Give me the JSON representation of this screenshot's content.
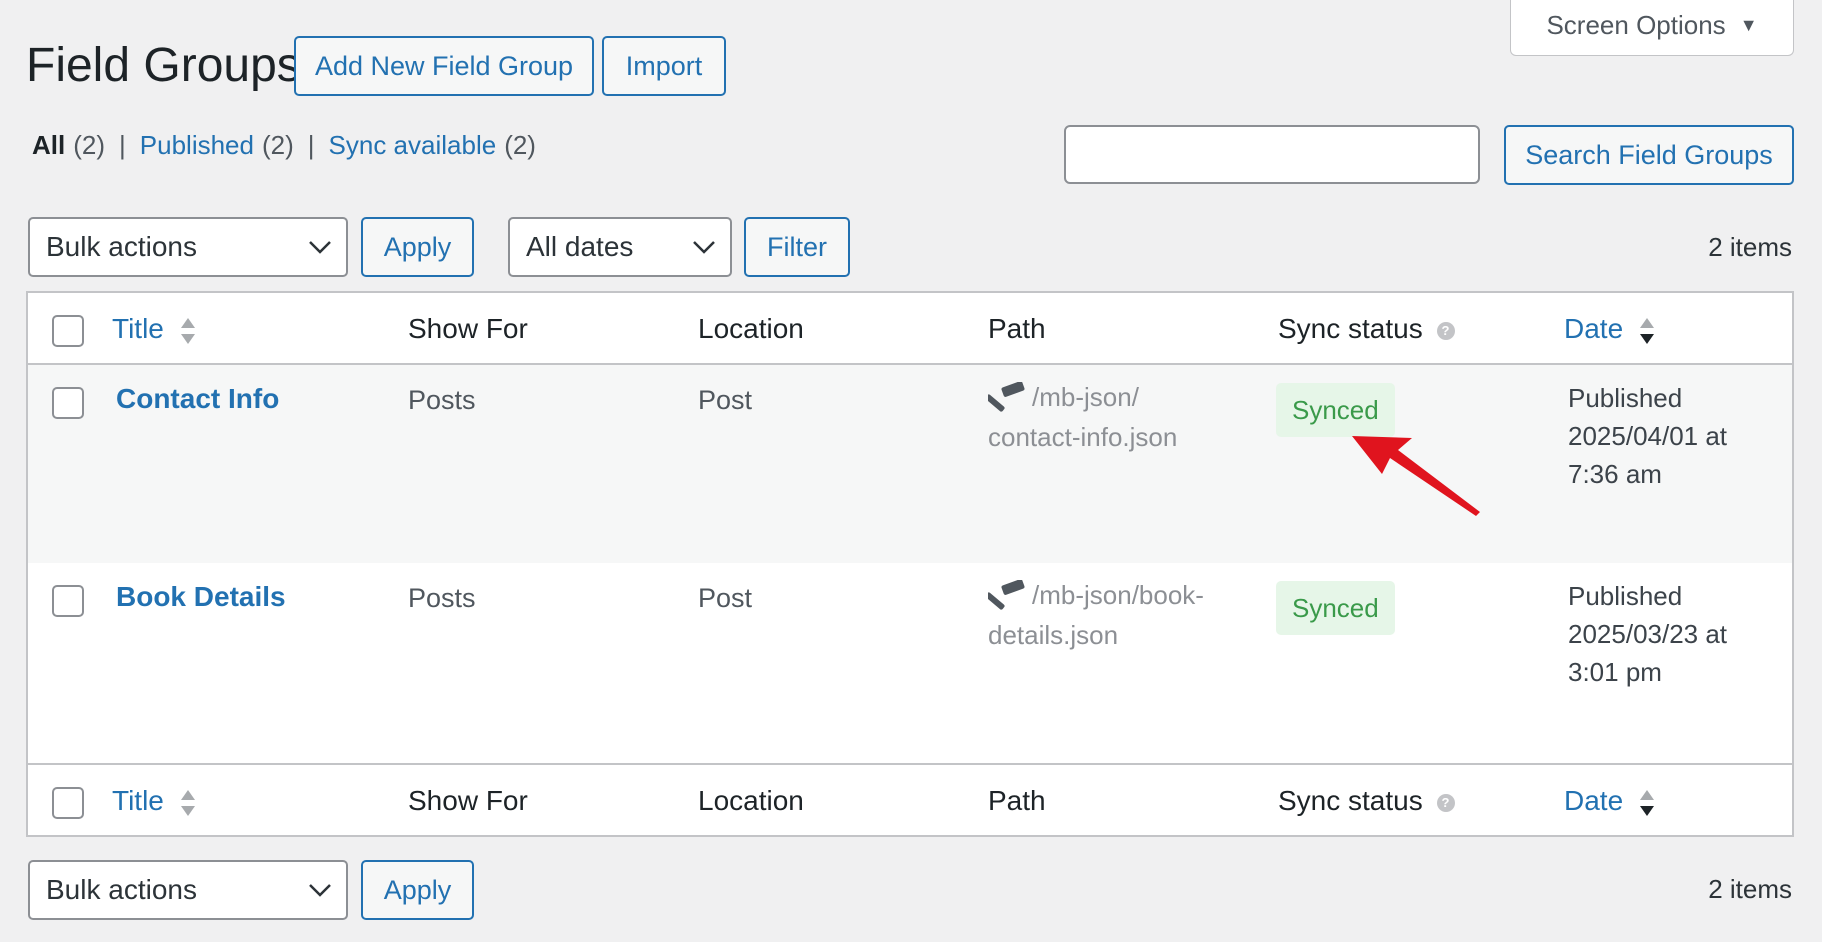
{
  "screen_options": {
    "label": "Screen Options"
  },
  "page": {
    "title": "Field Groups"
  },
  "header_buttons": {
    "add_new": "Add New Field Group",
    "import": "Import"
  },
  "views": [
    {
      "label": "All",
      "count": "(2)"
    },
    {
      "label": "Published",
      "count": "(2)"
    },
    {
      "label": "Sync available",
      "count": "(2)"
    }
  ],
  "view_separator": "|",
  "search": {
    "value": "",
    "button": "Search Field Groups"
  },
  "top_nav": {
    "bulk_selected": "Bulk actions",
    "apply": "Apply",
    "date_selected": "All dates",
    "filter": "Filter",
    "items": "2 items"
  },
  "bottom_nav": {
    "bulk_selected": "Bulk actions",
    "apply": "Apply",
    "items": "2 items"
  },
  "columns": {
    "title": "Title",
    "show_for": "Show For",
    "location": "Location",
    "path": "Path",
    "sync_status": "Sync status",
    "date": "Date"
  },
  "help_glyph": "?",
  "rows": [
    {
      "title": "Contact Info",
      "show_for": "Posts",
      "location": "Post",
      "path_line1": "/mb-json/",
      "path_line2": "contact-info.json",
      "sync": "Synced",
      "date_line1": "Published",
      "date_line2": "2025/04/01 at",
      "date_line3": "7:36 am"
    },
    {
      "title": "Book Details",
      "show_for": "Posts",
      "location": "Post",
      "path_line1": "/mb-json/book-",
      "path_line2": "details.json",
      "sync": "Synced",
      "date_line1": "Published",
      "date_line2": "2025/03/23 at",
      "date_line3": "3:01 pm"
    }
  ],
  "colors": {
    "accent": "#2271b1",
    "synced_bg": "#e6f6e8",
    "synced_text": "#3a9a4a",
    "annotation_arrow": "#e0141e"
  }
}
